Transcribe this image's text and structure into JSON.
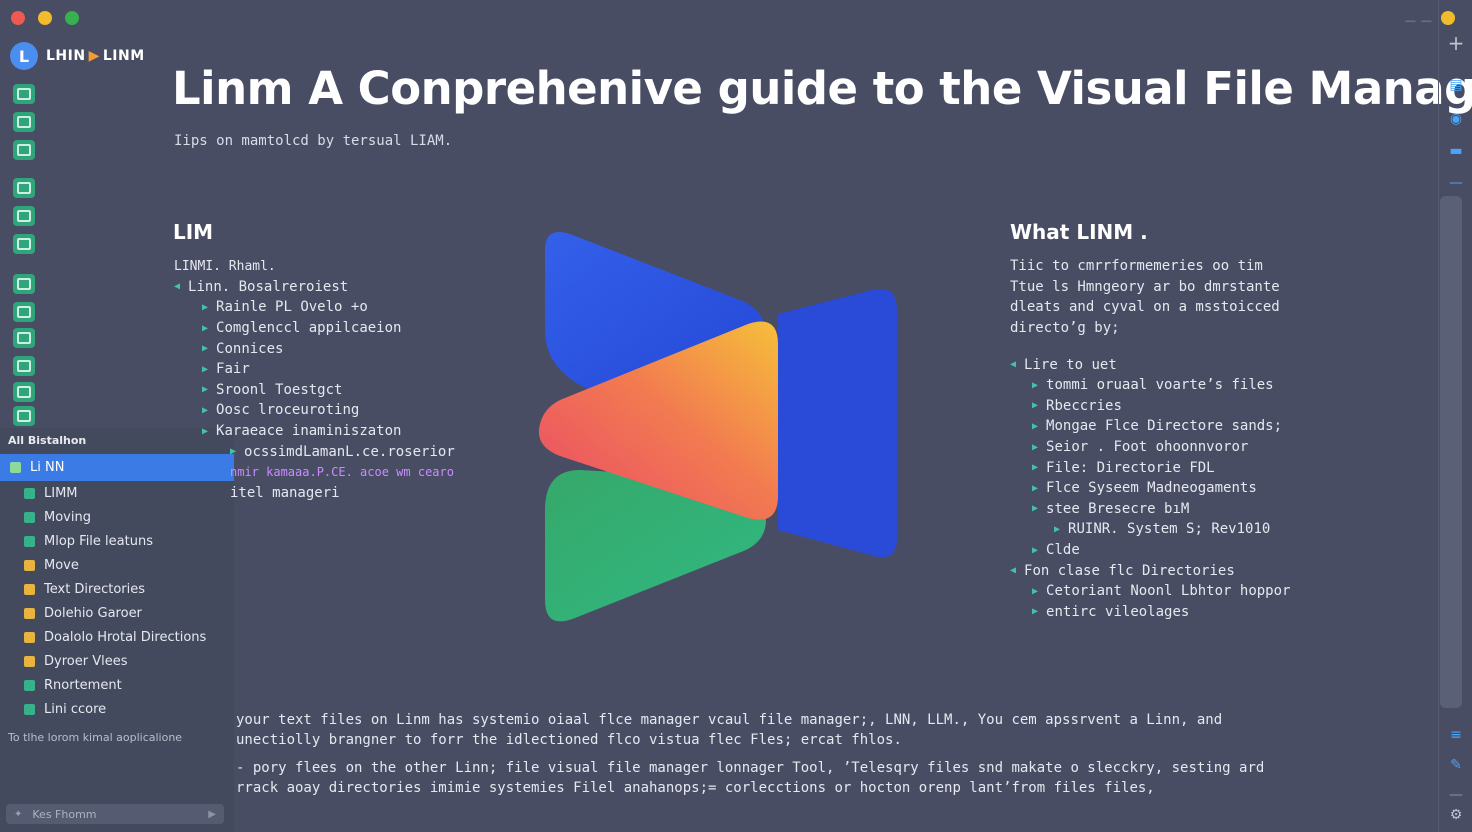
{
  "app": {
    "brand_left": "LHIN",
    "brand_right": "LINM"
  },
  "rail_icons": [
    "image-icon",
    "document-icon",
    "picture-icon",
    "folder-icon",
    "edit-icon",
    "circle-icon",
    "file-icon",
    "pin-icon",
    "sliders-icon",
    "refresh-icon",
    "chat-icon",
    "monitor-icon"
  ],
  "sidebar": {
    "section_label": "All Bistalhon",
    "items": [
      {
        "label": "Li NN",
        "icon": "green"
      },
      {
        "label": "LIMM",
        "icon": "green"
      },
      {
        "label": "Moving",
        "icon": "green"
      },
      {
        "label": "Mlop File leatuns",
        "icon": "green"
      },
      {
        "label": "Move",
        "icon": "yellow"
      },
      {
        "label": "Text Directories",
        "icon": "yellow"
      },
      {
        "label": "Dolehio Garoer",
        "icon": "yellow"
      },
      {
        "label": "Doalolo Hrotal Directions",
        "icon": "yellow"
      },
      {
        "label": "Dyroer Vlees",
        "icon": "yellow"
      },
      {
        "label": "Rnortement",
        "icon": "green"
      },
      {
        "label": "Lini ccore",
        "icon": "green"
      }
    ],
    "footer_text": "To tlhe lorom kimal aoplicalione",
    "status_placeholder": "Kes Fhomm"
  },
  "main": {
    "title": "Linm A Conprehenive guide to the Visual File Manager",
    "subtitle": "Iips on mamtolcd by tersual LIAM.",
    "left_heading": "LIM",
    "left_sub": "LINMI. Rhaml.",
    "left_items": [
      {
        "text": "Linn. Bosalreroiest",
        "level": 0
      },
      {
        "text": "Rainle PL Ovelo +o",
        "level": 1
      },
      {
        "text": "Comglenccl appilcaeion",
        "level": 1
      },
      {
        "text": "Connices",
        "level": 1
      },
      {
        "text": "Fair",
        "level": 1
      },
      {
        "text": "Sroonl Toestgct",
        "level": 1
      },
      {
        "text": "Oosc lroceuroting",
        "level": 1
      },
      {
        "text": "Karaeace inaminiszaton",
        "level": 1
      },
      {
        "text": "ocssimdLamanL.ce.roserior",
        "level": 2
      }
    ],
    "left_highlight": "nmir kamaaa.P.CE. acoe wm cearo",
    "left_tail": "itel manageri",
    "right_heading": "What LINM .",
    "right_para": [
      "Tiic to cmrrformemeries oo tim",
      "Ttue ls Hmngeory ar bo dmrstante",
      "dleats and cyval on a msstoicced",
      "directo’g by;"
    ],
    "right_items": [
      {
        "text": "Lire to uet",
        "level": 0
      },
      {
        "text": "tommi oruaal voarte’s files",
        "level": 1
      },
      {
        "text": "Rbeccries",
        "level": 1
      },
      {
        "text": "Mongae Flce Directore sands;",
        "level": 1
      },
      {
        "text": "Seior . Foot ohoonnvoror",
        "level": 1
      },
      {
        "text": "File: Directorie FDL",
        "level": 1
      },
      {
        "text": "Flce Syseem Madneogaments",
        "level": 1
      },
      {
        "text": "stee Bresecre bıM",
        "level": 1
      },
      {
        "text": "RUINR. System S; Rev1010",
        "level": 2
      },
      {
        "text": "Clde",
        "level": 1
      },
      {
        "text": "Fon clase flc Directories",
        "level": 0
      },
      {
        "text": "Cetoriant Noonl Lbhtor hoppor",
        "level": 1
      },
      {
        "text": "entirc vileolages",
        "level": 1
      }
    ],
    "bottom_lines": [
      "your text files on Linm has systemio oiaal flce manager vcaul file manager;, LNN, LLM., You cem apssrvent a Linn, and",
      "unectiolly brangner to forr the idlectioned flco vistua flec Fles; ercat fhlos.",
      "- pory flees on the other Linn; file visual file manager lonnager Tool, ’Telesqry files snd makate o slecckry, sesting ard",
      "rrack aoay directories imimie systemies Filel anahanops;= corlecctions or hocton orenp lant’from files files,"
    ]
  },
  "right_rail_icons": [
    "plus-icon",
    "doc-icon",
    "compass-icon",
    "folder-icon",
    "minus-icon",
    "list-icon",
    "bookmark-icon",
    "divider-icon",
    "settings-icon"
  ],
  "colors": {
    "background": "#484d63",
    "accent": "#3a7be5",
    "tree_icon_green": "#36b28a",
    "tree_icon_yellow": "#e9b33f"
  }
}
